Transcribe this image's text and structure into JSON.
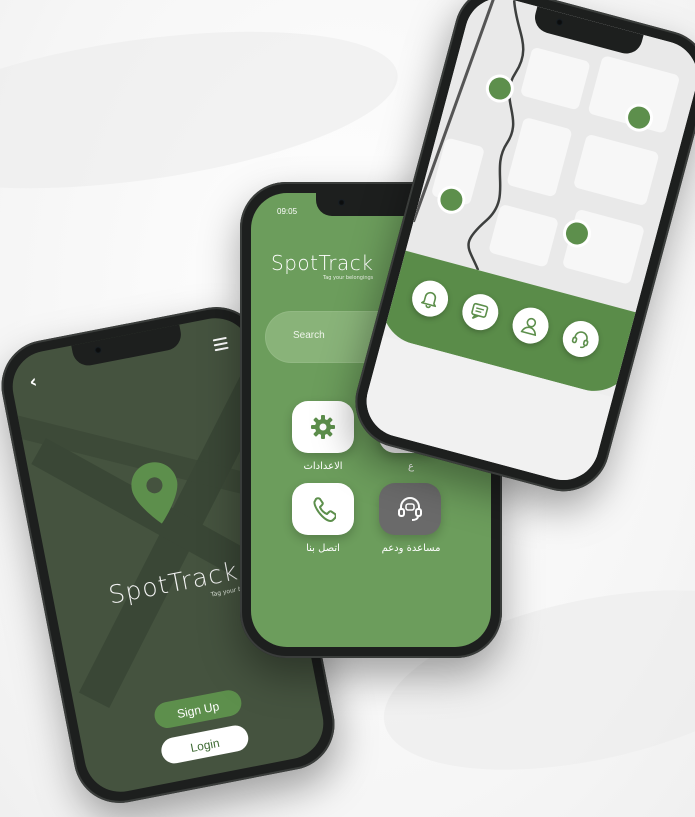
{
  "brand": {
    "name": "SpotTrack",
    "tagline": "Tag your belongings"
  },
  "welcome_screen": {
    "back_icon": "chevron-left-icon",
    "menu_icon": "hamburger-menu-icon",
    "logo_icon": "map-pin-icon",
    "signup_label": "Sign Up",
    "login_label": "Login"
  },
  "home_screen": {
    "status_time": "09:05",
    "search_placeholder": "Search",
    "tiles": [
      {
        "label": "الاعدادات",
        "icon": "gear-icon"
      },
      {
        "label": "ع",
        "icon": "list-icon"
      },
      {
        "label": "اتصل بنا",
        "icon": "phone-icon"
      },
      {
        "label": "مساعدة ودعم",
        "icon": "support-headset-icon"
      }
    ]
  },
  "map_screen": {
    "actions": [
      {
        "icon": "bell-icon"
      },
      {
        "icon": "chat-icon"
      },
      {
        "icon": "user-icon"
      },
      {
        "icon": "support-headset-icon"
      }
    ]
  },
  "colors": {
    "brand_green": "#5d8f4c",
    "screen_green": "#6c9d5c",
    "dark_green": "#45533f",
    "phone_frame": "#1d1f1e"
  }
}
